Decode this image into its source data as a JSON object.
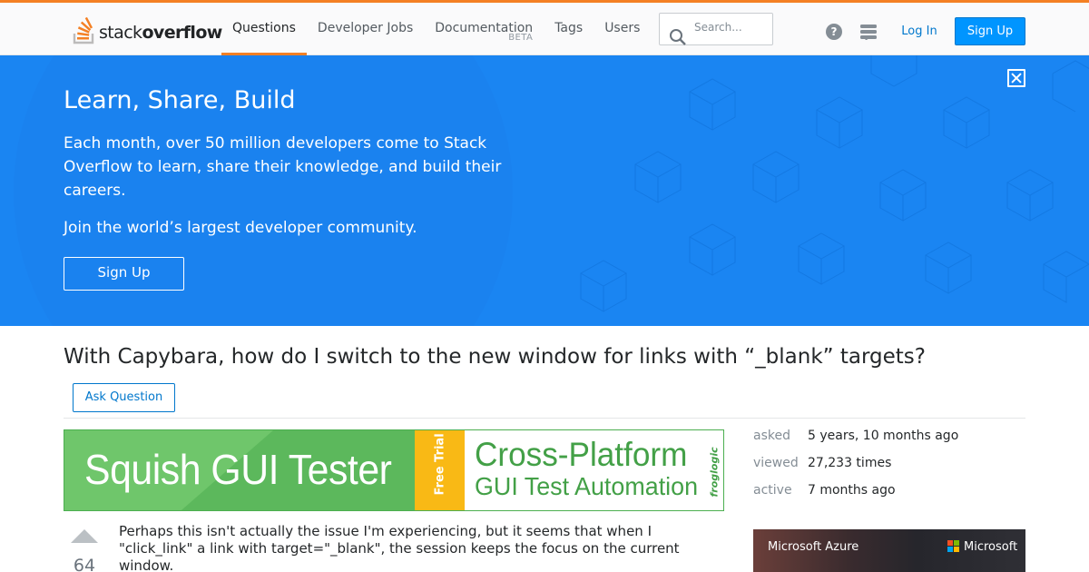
{
  "header": {
    "logo_word_stack": "stack",
    "logo_word_overflow": "overflow",
    "nav": [
      {
        "label": "Questions",
        "sub": ""
      },
      {
        "label": "Developer Jobs",
        "sub": ""
      },
      {
        "label": "Documentation",
        "sub": "BETA"
      },
      {
        "label": "Tags",
        "sub": ""
      },
      {
        "label": "Users",
        "sub": ""
      }
    ],
    "search_placeholder": "Search...",
    "help_glyph": "?",
    "login_label": "Log In",
    "signup_label": "Sign Up",
    "accent_color": "#f48024"
  },
  "hero": {
    "title": "Learn, Share, Build",
    "description": "Each month, over 50 million developers come to Stack Overflow to learn, share their knowledge, and build their careers.",
    "join_text": "Join the world’s largest developer community.",
    "signup_label": "Sign Up",
    "background_color": "#1a85f2"
  },
  "question": {
    "title": "With Capybara, how do I switch to the new window for links with “_blank” targets?",
    "ask_button_label": "Ask Question",
    "votes": "64",
    "body": "Perhaps this isn't actually the issue I'm experiencing, but it seems that when I \"click_link\" a link with target=\"_blank\", the session keeps the focus on the current window."
  },
  "ad": {
    "product": "Squish GUI Tester",
    "trial": "Free Trial",
    "headline": "Cross-Platform",
    "subheadline": "GUI Test Automation",
    "brand": "froglogic",
    "color": "#5cb85c"
  },
  "stats": [
    {
      "label": "asked",
      "value": "5 years, 10 months ago"
    },
    {
      "label": "viewed",
      "value": "27,233 times"
    },
    {
      "label": "active",
      "value": "7 months ago"
    }
  ],
  "side_ad": {
    "title": "Microsoft Azure",
    "brand": "Microsoft"
  }
}
